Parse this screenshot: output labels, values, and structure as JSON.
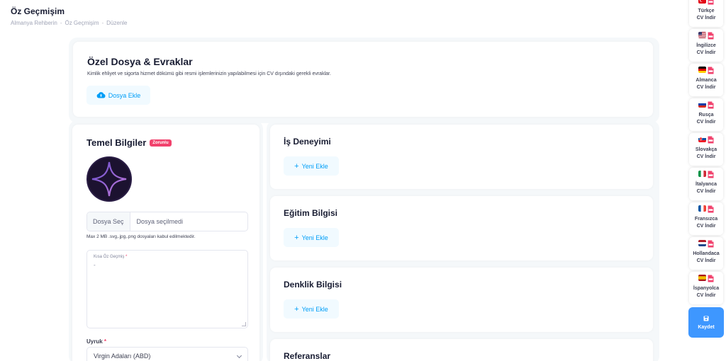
{
  "header": {
    "title": "Öz Geçmişim",
    "breadcrumb": [
      "Almanya Rehberin",
      "Öz Geçmişim",
      "Düzenle"
    ],
    "separator": "-"
  },
  "docs": {
    "title": "Özel Dosya & Evraklar",
    "description": "Kimlik ehliyet ve sigorta hizmet dökümü gibi resmi işlemlerinizin yapılabilmesi için CV dışındaki gerekli evraklar.",
    "add_label": "Dosya Ekle"
  },
  "basic": {
    "title": "Temel Bilgiler",
    "required_badge": "Zorunlu",
    "file_button": "Dosya Seç",
    "file_status": "Dosya seçilmedi",
    "file_hint": "Max 2 MB .svg,.jpg,.png dosyaları kabul edilmektedir.",
    "summary_label": "Kısa Öz Geçmiş",
    "summary_value": "-",
    "nationality_label": "Uyruk",
    "nationality_value": "Virgin Adaları (ABD)",
    "required_mark": "*"
  },
  "sections": [
    {
      "title": "İş Deneyimi",
      "add_label": "Yeni Ekle"
    },
    {
      "title": "Eğitim Bilgisi",
      "add_label": "Yeni Ekle"
    },
    {
      "title": "Denklik Bilgisi",
      "add_label": "Yeni Ekle"
    },
    {
      "title": "Referanslar"
    }
  ],
  "add_symbol": "+",
  "sidebar": {
    "items": [
      {
        "lang": "Türkçe",
        "cv": "CV İndir",
        "flag": "tr"
      },
      {
        "lang": "İngilizce",
        "cv": "CV İndir",
        "flag": "us"
      },
      {
        "lang": "Almanca",
        "cv": "CV İndir",
        "flag": "de"
      },
      {
        "lang": "Rusça",
        "cv": "CV İndir",
        "flag": "ru"
      },
      {
        "lang": "Slovakça",
        "cv": "CV İndir",
        "flag": "sk"
      },
      {
        "lang": "İtalyanca",
        "cv": "CV İndir",
        "flag": "it"
      },
      {
        "lang": "Fransızca",
        "cv": "CV İndir",
        "flag": "fr"
      },
      {
        "lang": "Hollandaca",
        "cv": "CV İndir",
        "flag": "nl"
      },
      {
        "lang": "İspanyolca",
        "cv": "CV İndir",
        "flag": "es"
      }
    ],
    "save_label": "Kaydet"
  },
  "colors": {
    "primary": "#009ef7",
    "primary_light": "#f1faff",
    "danger": "#f1416c",
    "save": "#3e97ff"
  }
}
